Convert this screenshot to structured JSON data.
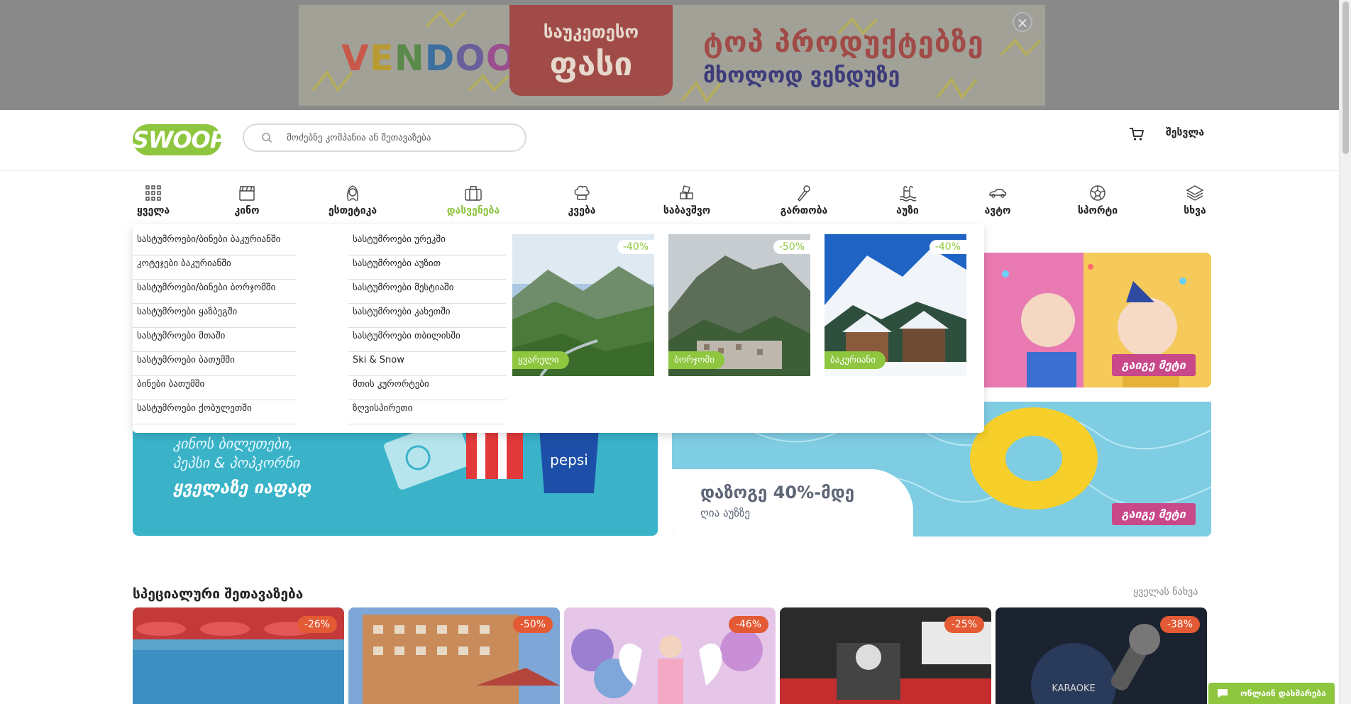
{
  "ad": {
    "brand_letters": [
      "V",
      "E",
      "N",
      "D",
      "O",
      "O"
    ],
    "box_line1": "საუკეთესო",
    "box_line2": "ფასი",
    "headline1": "ტოპ პროდუქტებზე",
    "headline2": "მხოლოდ ვენდუზე",
    "close_glyph": "×"
  },
  "header": {
    "logo": "SWOOP",
    "search_placeholder": "მოძებნე კომპანია ან შეთავაზება",
    "login": "შესვლა"
  },
  "nav": [
    {
      "label": "ყველა",
      "icon": "grid-icon"
    },
    {
      "label": "კინო",
      "icon": "clapperboard-icon"
    },
    {
      "label": "ესთეტიკა",
      "icon": "face-icon"
    },
    {
      "label": "დასვენება",
      "icon": "suitcase-icon",
      "active": true
    },
    {
      "label": "კვება",
      "icon": "chef-hat-icon"
    },
    {
      "label": "საბავშვო",
      "icon": "blocks-icon"
    },
    {
      "label": "გართობა",
      "icon": "microphone-icon"
    },
    {
      "label": "აუზი",
      "icon": "pool-icon"
    },
    {
      "label": "ავტო",
      "icon": "car-icon"
    },
    {
      "label": "სპორტი",
      "icon": "ball-icon"
    },
    {
      "label": "სხვა",
      "icon": "layers-icon"
    }
  ],
  "mega": {
    "col1": [
      "სასტუმროები/ბინები ბაკურიანში",
      "კოტეჯები ბაკურიანში",
      "სასტუმროები/ბინები ბორჯომში",
      "სასტუმროები ყაზბეგში",
      "სასტუმროები მთაში",
      "სასტუმროები ბათუმში",
      "ბინები ბათუმში",
      "სასტუმროები ქობულეთში"
    ],
    "col2": [
      "სასტუმროები ურეკში",
      "სასტუმროები აუზით",
      "სასტუმროები მესტიაში",
      "სასტუმროები კახეთში",
      "სასტუმროები თბილისში",
      "Ski & Snow",
      "მთის კურორტები",
      "ზღვისპირეთი"
    ],
    "tiles": [
      {
        "discount": "-40%",
        "label": "ყვარელი"
      },
      {
        "discount": "-50%",
        "label": "ბორჯომი"
      },
      {
        "discount": "-40%",
        "label": "ბაკურიანი"
      }
    ]
  },
  "promos": {
    "cinema_line1": "კინოს ბილეთები,",
    "cinema_line2": "პეპსი & პოპკორნი",
    "cinema_line3": "ყველაზე იაფად",
    "pepsi": "pepsi",
    "pool_title": "დაზოგე 40%-მდე",
    "pool_sub": "ღია აუზზე",
    "cta": "გაიგე მეტი"
  },
  "special": {
    "title": "სპეციალური შეთავაზება",
    "see_all": "ყველას ნახვა",
    "cards": [
      {
        "discount": "-26%"
      },
      {
        "discount": "-50%"
      },
      {
        "discount": "-46%"
      },
      {
        "discount": "-25%"
      },
      {
        "discount": "-38%"
      }
    ],
    "karaoke_text": "KARAOKE"
  },
  "chat": {
    "label": "ონლაინ დახმარება"
  },
  "colors": {
    "accent": "#8ec63f",
    "pink": "#c9488a",
    "badge": "#e35a34"
  }
}
